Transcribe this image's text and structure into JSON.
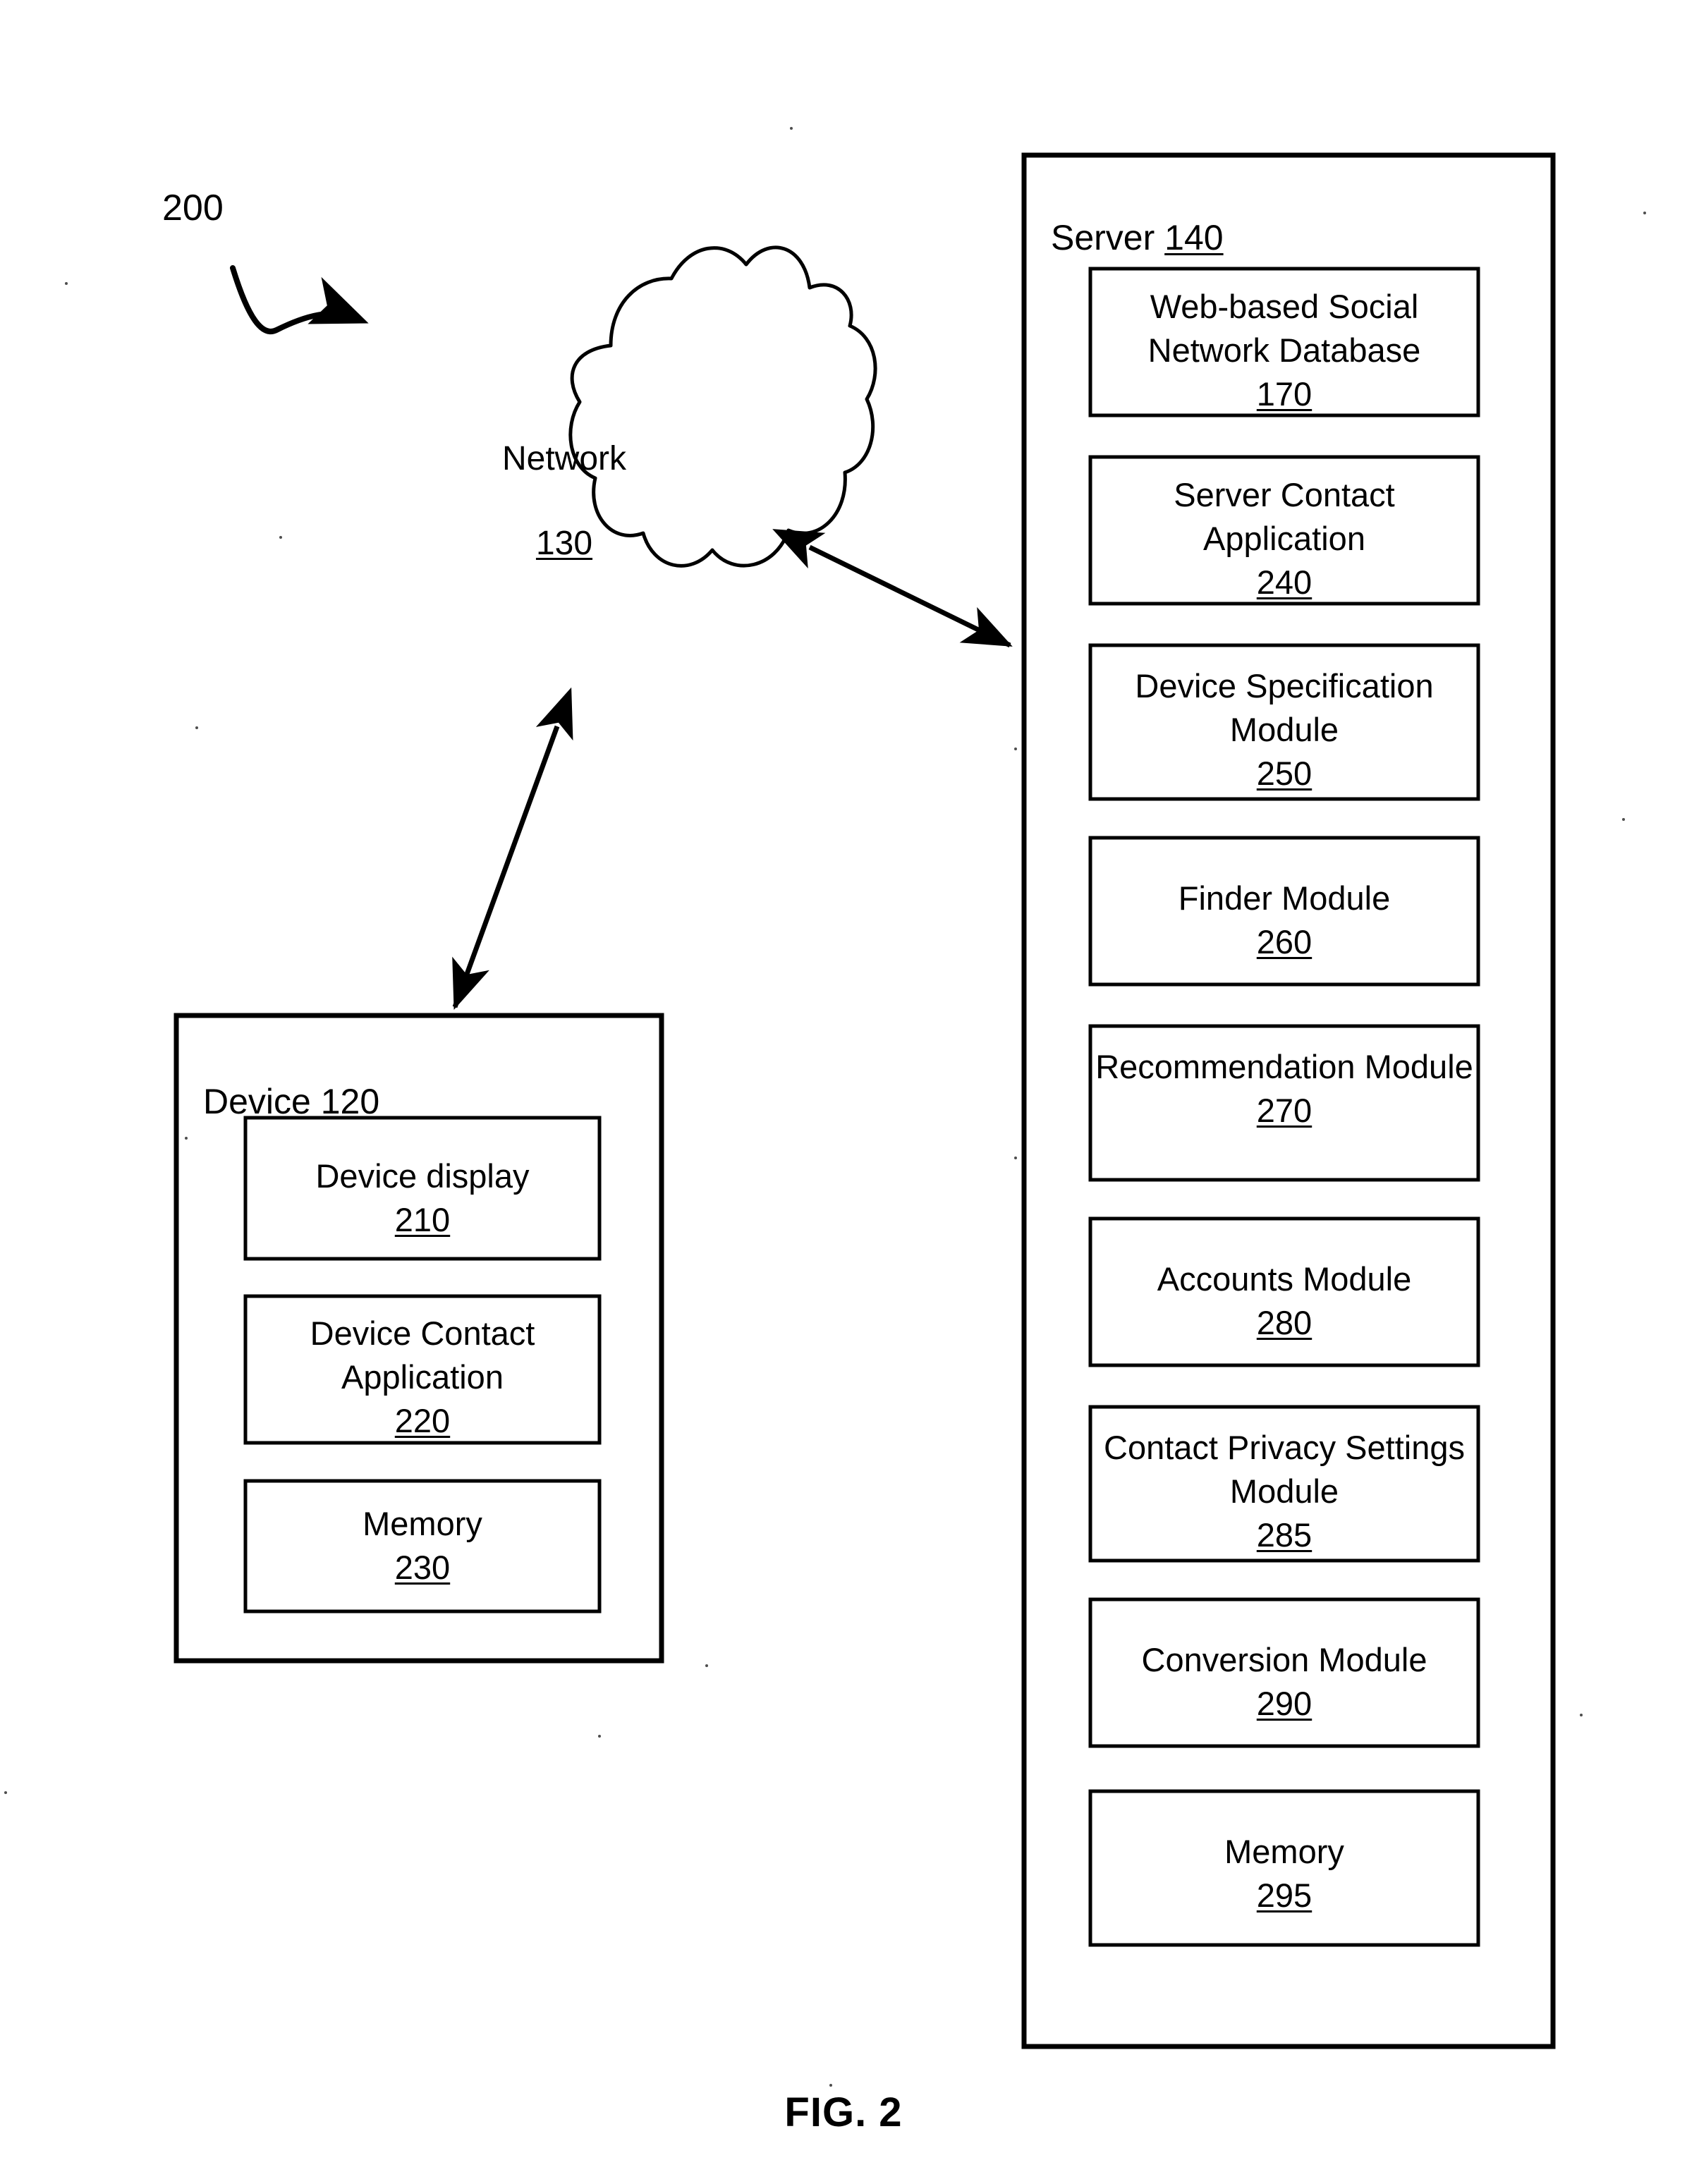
{
  "figure": {
    "caption": "FIG. 2",
    "system_label": "200"
  },
  "network": {
    "label": "Network",
    "ref": "130"
  },
  "device": {
    "title_label": "Device",
    "title_ref": "120",
    "modules": [
      {
        "name": "Device display",
        "ref": "210"
      },
      {
        "name": "Device Contact\nApplication",
        "ref": "220"
      },
      {
        "name": "Memory",
        "ref": "230"
      }
    ]
  },
  "server": {
    "title_label": "Server",
    "title_ref": "140",
    "modules": [
      {
        "name": "Web-based Social\nNetwork Database",
        "ref": "170"
      },
      {
        "name": "Server Contact\nApplication",
        "ref": "240"
      },
      {
        "name": "Device Specification\nModule",
        "ref": "250"
      },
      {
        "name": "Finder Module",
        "ref": "260"
      },
      {
        "name": "Recommendation\nModule",
        "ref": "270"
      },
      {
        "name": "Accounts Module",
        "ref": "280"
      },
      {
        "name": "Contact Privacy\nSettings Module",
        "ref": "285"
      },
      {
        "name": "Conversion Module",
        "ref": "290"
      },
      {
        "name": "Memory",
        "ref": "295"
      }
    ]
  },
  "connectors": [
    {
      "name": "network-to-server-link",
      "kind": "double-headed-arrow"
    },
    {
      "name": "network-to-device-link",
      "kind": "double-headed-arrow"
    },
    {
      "name": "system-pointer-arrow",
      "kind": "curved-arrow"
    }
  ],
  "style": {
    "stroke": "#000000",
    "background": "#ffffff"
  }
}
